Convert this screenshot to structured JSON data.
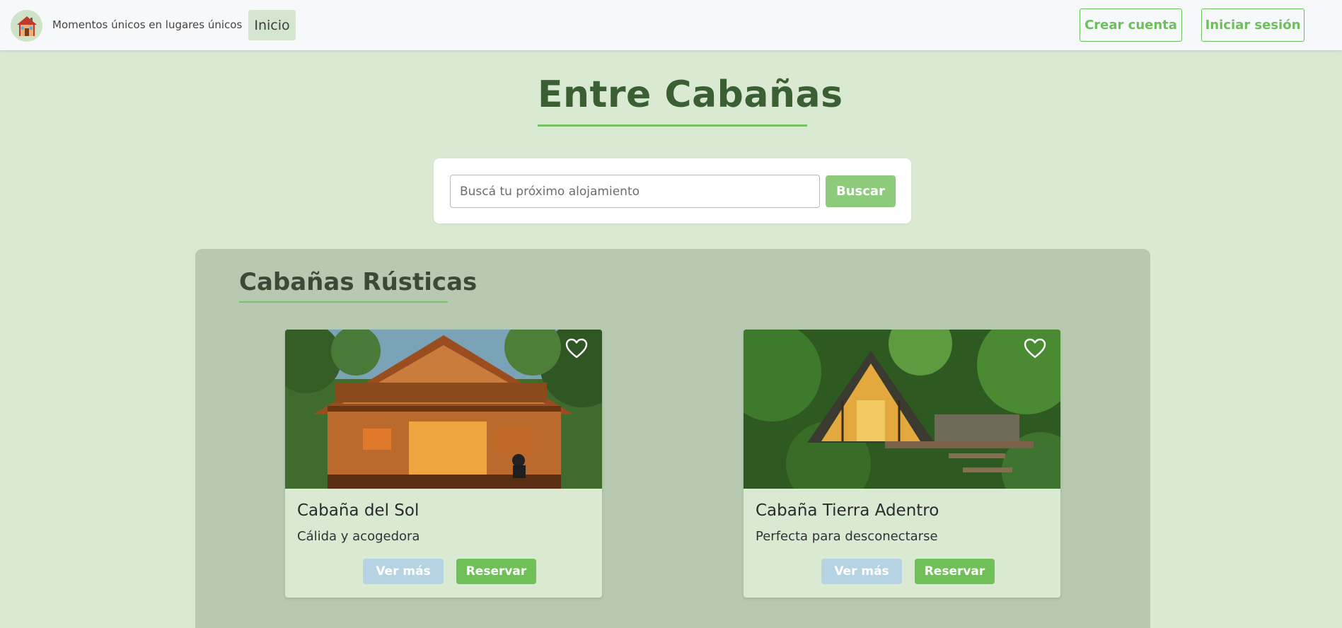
{
  "header": {
    "logo_icon": "house-icon",
    "tagline": "Momentos únicos en lugares únicos",
    "nav_home": "Inicio",
    "create_account": "Crear cuenta",
    "login": "Iniciar sesión"
  },
  "hero": {
    "title": "Entre Cabañas"
  },
  "search": {
    "placeholder": "Buscá tu próximo alojamiento",
    "value": "",
    "button": "Buscar"
  },
  "section": {
    "title": "Cabañas Rústicas",
    "cards": [
      {
        "title": "Cabaña del Sol",
        "description": "Cálida y acogedora",
        "more_label": "Ver más",
        "book_label": "Reservar",
        "favorite_icon": "heart-icon"
      },
      {
        "title": "Cabaña Tierra Adentro",
        "description": "Perfecta para desconectarse",
        "more_label": "Ver más",
        "book_label": "Reservar",
        "favorite_icon": "heart-icon"
      }
    ]
  },
  "colors": {
    "background": "#d9e9d2",
    "accent": "#6fc056",
    "panel": "#b8c9b1",
    "title": "#3a5f33"
  }
}
